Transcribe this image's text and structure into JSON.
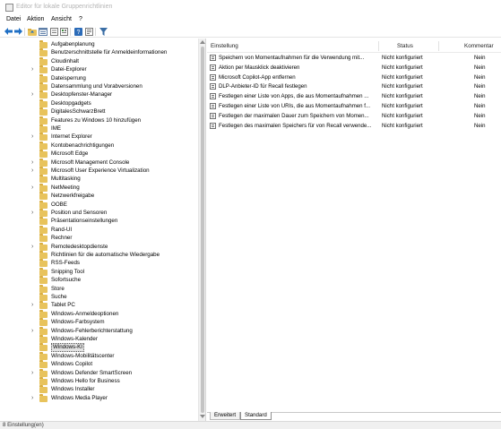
{
  "window": {
    "title": "Editor für lokale Gruppenrichtlinien"
  },
  "menu": [
    {
      "label": "Datei"
    },
    {
      "label": "Aktion"
    },
    {
      "label": "Ansicht"
    },
    {
      "label": "?"
    }
  ],
  "toolbar": {
    "icons": [
      "back-arrow-icon",
      "forward-arrow-icon",
      "up-folder-icon",
      "show-hide-tree-icon",
      "refresh-icon",
      "export-list-icon",
      "help-icon",
      "properties-icon",
      "filter-icon"
    ],
    "colors": {
      "arrow": "#1f6fc4",
      "help": "#2b6bb8",
      "filter": "#3a6ea5"
    }
  },
  "tree": {
    "items": [
      {
        "label": "Aufgabenplanung",
        "expandable": false
      },
      {
        "label": "Benutzerschnittstelle für Anmeldeinformationen",
        "expandable": false
      },
      {
        "label": "Cloudinhalt",
        "expandable": false
      },
      {
        "label": "Datei-Explorer",
        "expandable": true
      },
      {
        "label": "Dateisperrung",
        "expandable": false
      },
      {
        "label": "Datensammlung und Vorabversionen",
        "expandable": false
      },
      {
        "label": "Desktopfenster-Manager",
        "expandable": true
      },
      {
        "label": "Desktopgadgets",
        "expandable": false
      },
      {
        "label": "DigitalesSchwarzBrett",
        "expandable": false
      },
      {
        "label": "Features zu Windows 10 hinzufügen",
        "expandable": false
      },
      {
        "label": "IME",
        "expandable": false
      },
      {
        "label": "Internet Explorer",
        "expandable": true
      },
      {
        "label": "Kontobenachrichtigungen",
        "expandable": false
      },
      {
        "label": "Microsoft Edge",
        "expandable": false
      },
      {
        "label": "Microsoft Management Console",
        "expandable": true
      },
      {
        "label": "Microsoft User Experience Virtualization",
        "expandable": true
      },
      {
        "label": "Multitasking",
        "expandable": false
      },
      {
        "label": "NetMeeting",
        "expandable": true
      },
      {
        "label": "Netzwerkfreigabe",
        "expandable": false
      },
      {
        "label": "OOBE",
        "expandable": false
      },
      {
        "label": "Position und Sensoren",
        "expandable": true
      },
      {
        "label": "Präsentationseinstellungen",
        "expandable": false
      },
      {
        "label": "Rand-UI",
        "expandable": false
      },
      {
        "label": "Rechner",
        "expandable": false
      },
      {
        "label": "Remotedesktopdienste",
        "expandable": true
      },
      {
        "label": "Richtlinien für die automatische Wiedergabe",
        "expandable": false
      },
      {
        "label": "RSS-Feeds",
        "expandable": false
      },
      {
        "label": "Snipping Tool",
        "expandable": false
      },
      {
        "label": "Sofortsuche",
        "expandable": false
      },
      {
        "label": "Store",
        "expandable": false
      },
      {
        "label": "Suche",
        "expandable": false
      },
      {
        "label": "Tablet PC",
        "expandable": true
      },
      {
        "label": "Windows-Anmeldeoptionen",
        "expandable": false
      },
      {
        "label": "Windows-Farbsystem",
        "expandable": false
      },
      {
        "label": "Windows-Fehlerberichterstattung",
        "expandable": true
      },
      {
        "label": "Windows-Kalender",
        "expandable": false
      },
      {
        "label": "Windows-KI",
        "expandable": false,
        "selected": true
      },
      {
        "label": "Windows-Mobilitätscenter",
        "expandable": false
      },
      {
        "label": "Windows Copilot",
        "expandable": false
      },
      {
        "label": "Windows Defender SmartScreen",
        "expandable": true
      },
      {
        "label": "Windows Hello for Business",
        "expandable": false
      },
      {
        "label": "Windows Installer",
        "expandable": false
      },
      {
        "label": "Windows Media Player",
        "expandable": true
      }
    ]
  },
  "table": {
    "columns": {
      "name": "Einstellung",
      "status": "Status",
      "comment": "Kommentar"
    },
    "rows": [
      {
        "name": "Speichern von Momentaufnahmen für die Verwendung mit...",
        "status": "Nicht konfiguriert",
        "comment": "Nein"
      },
      {
        "name": "Aktion per Mausklick deaktivieren",
        "status": "Nicht konfiguriert",
        "comment": "Nein"
      },
      {
        "name": "Microsoft Copilot-App entfernen",
        "status": "Nicht konfiguriert",
        "comment": "Nein"
      },
      {
        "name": "DLP-Anbieter-ID für Recall festlegen",
        "status": "Nicht konfiguriert",
        "comment": "Nein"
      },
      {
        "name": "Festlegen einer Liste von Apps, die aus Momentaufnahmen ...",
        "status": "Nicht konfiguriert",
        "comment": "Nein"
      },
      {
        "name": "Festlegen einer Liste von URIs, die aus Momentaufnahmen f...",
        "status": "Nicht konfiguriert",
        "comment": "Nein"
      },
      {
        "name": "Festlegen der maximalen Dauer zum Speichern von Momen...",
        "status": "Nicht konfiguriert",
        "comment": "Nein"
      },
      {
        "name": "Festlegen des maximalen Speichers für von Recall verwende...",
        "status": "Nicht konfiguriert",
        "comment": "Nein"
      }
    ]
  },
  "tabs": [
    {
      "label": "Erweitert",
      "active": false
    },
    {
      "label": "Standard",
      "active": true
    }
  ],
  "status": {
    "text": "8 Einstellung(en)"
  }
}
